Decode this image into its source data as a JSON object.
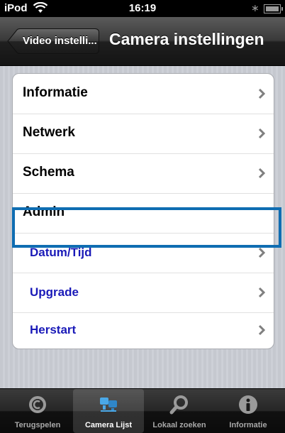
{
  "status_bar": {
    "carrier": "iPod",
    "time": "16:19"
  },
  "nav": {
    "back_label": "Video instelli...",
    "title": "Camera instellingen"
  },
  "menu": {
    "informatie": "Informatie",
    "netwerk": "Netwerk",
    "schema": "Schema",
    "admin": "Admin",
    "datum_tijd": "Datum/Tijd",
    "upgrade": "Upgrade",
    "herstart": "Herstart"
  },
  "tabs": [
    {
      "label": "Terugspelen",
      "icon": "replay-icon"
    },
    {
      "label": "Camera Lijst",
      "icon": "camera-list-icon",
      "active": true
    },
    {
      "label": "Lokaal zoeken",
      "icon": "search-icon"
    },
    {
      "label": "Informatie",
      "icon": "info-icon"
    }
  ],
  "colors": {
    "sub_item": "#1a1ab8",
    "highlight": "#0f6db2",
    "navbar": "#2a2a2a"
  }
}
